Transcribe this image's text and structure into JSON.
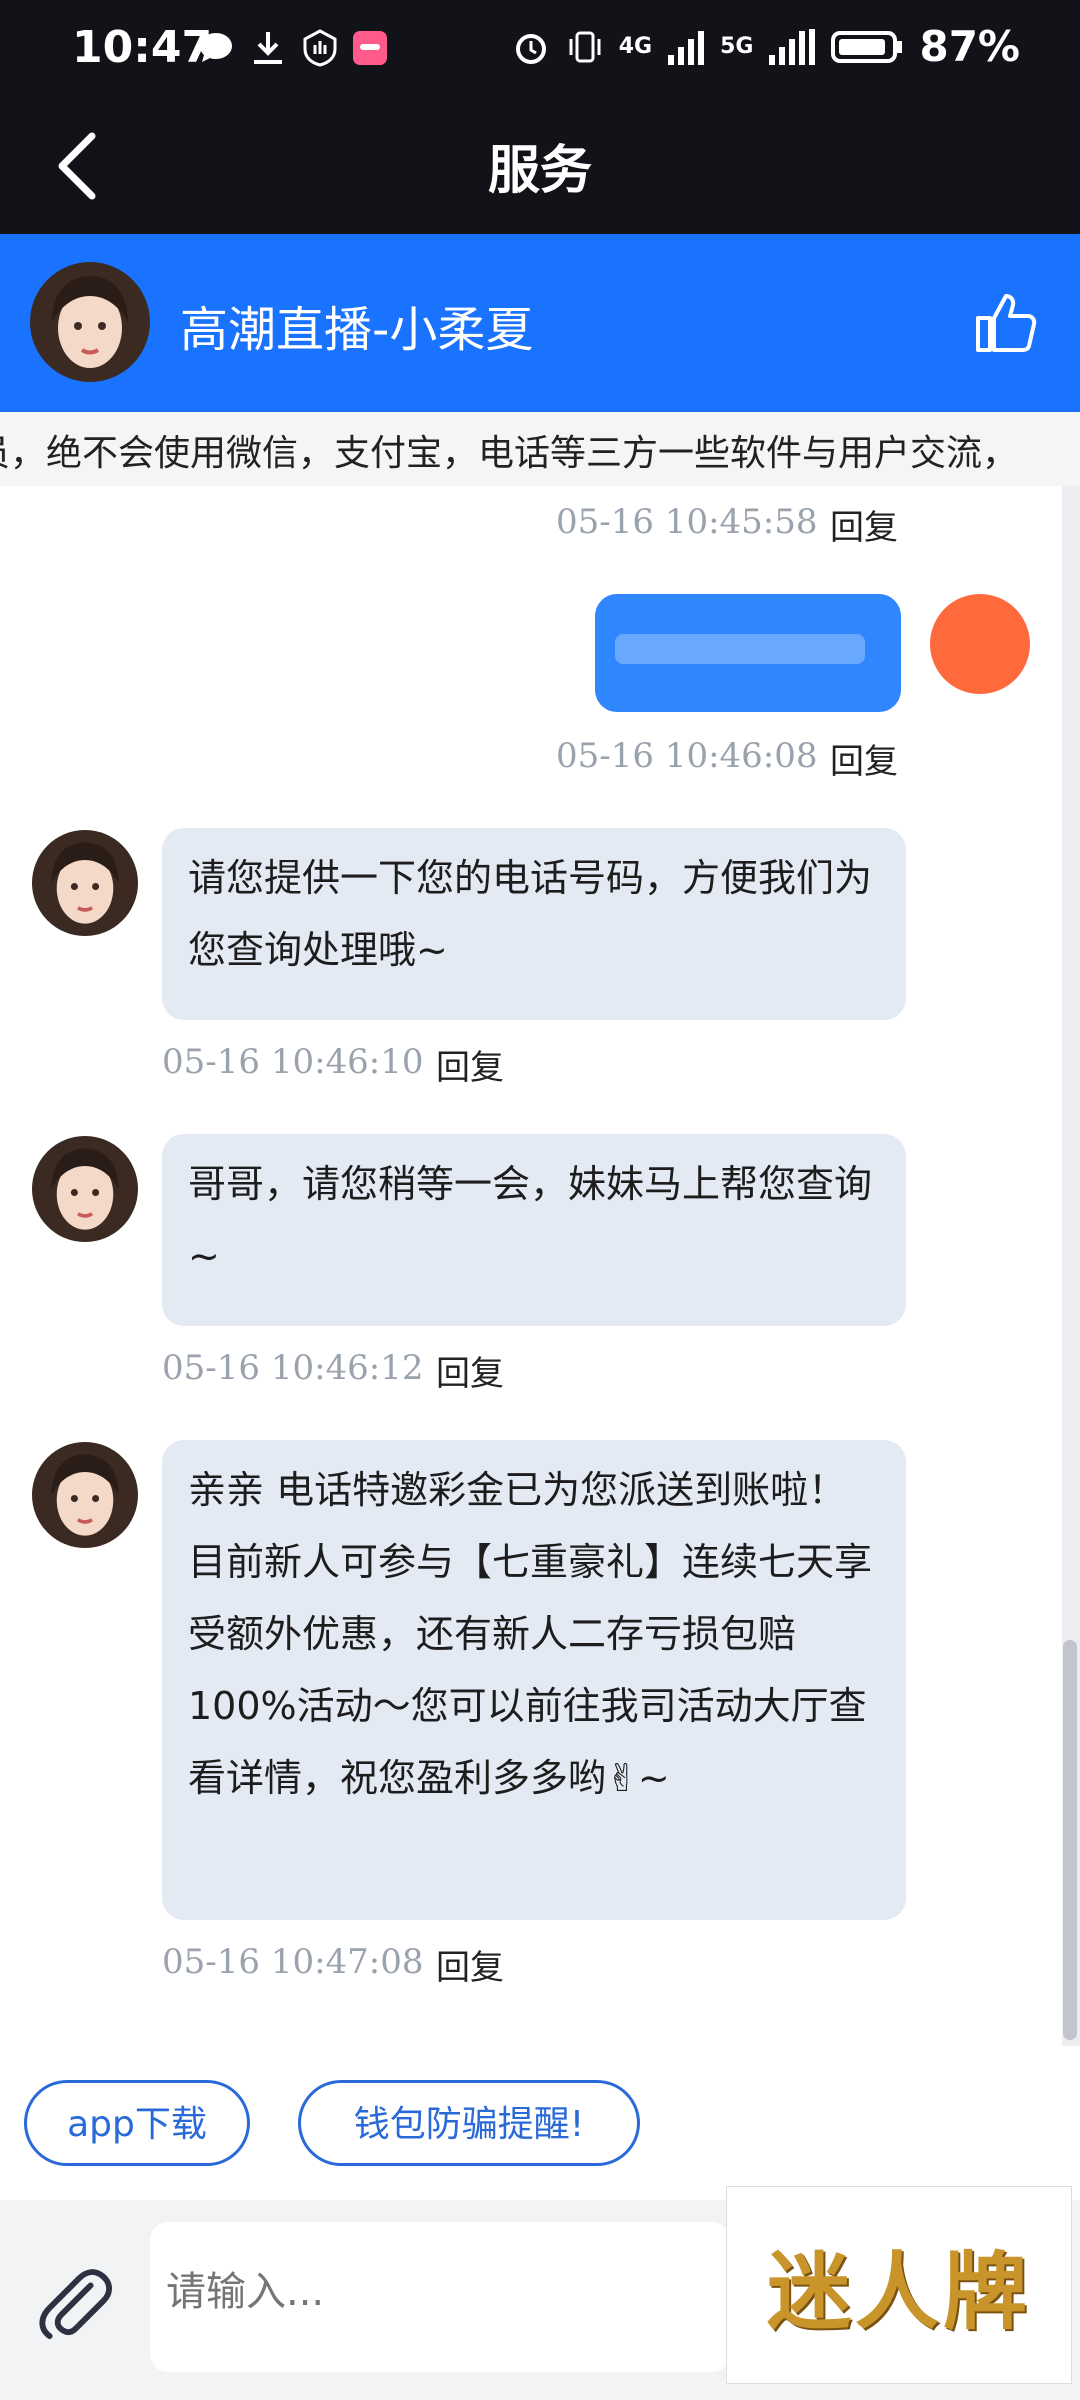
{
  "status_bar": {
    "time": "10:47",
    "battery": "87%",
    "network1": "4G",
    "network2": "5G"
  },
  "nav": {
    "title": "服务"
  },
  "header": {
    "agent_name": "高潮直播-小柔夏"
  },
  "notice": {
    "text": "员，绝不会使用微信，支付宝，电话等三方一些软件与用户交流，"
  },
  "chat": {
    "reply_label": "回复",
    "top_timestamp": "05-16 10:45:58",
    "sent_timestamp": "05-16 10:46:08",
    "messages": [
      {
        "text": "请您提供一下您的电话号码，方便我们为您查询处理哦~",
        "timestamp": "05-16 10:46:10"
      },
      {
        "text": "哥哥，请您稍等一会，妹妹马上帮您查询~",
        "timestamp": "05-16 10:46:12"
      },
      {
        "text": "亲亲 电话特邀彩金已为您派送到账啦！目前新人可参与【七重豪礼】连续七天享受额外优惠，还有新人二存亏损包赔100%活动～您可以前往我司活动大厅查看详情，祝您盈利多多哟✌~",
        "timestamp": "05-16 10:47:08"
      }
    ]
  },
  "quick_buttons": [
    {
      "label": "app下载"
    },
    {
      "label": "钱包防骗提醒!"
    }
  ],
  "input": {
    "placeholder": "请输入..."
  },
  "watermark": {
    "text": "迷人牌"
  },
  "colors": {
    "brand_blue": "#1a73ff",
    "bubble": "#e4eaf3",
    "dark": "#111318"
  }
}
